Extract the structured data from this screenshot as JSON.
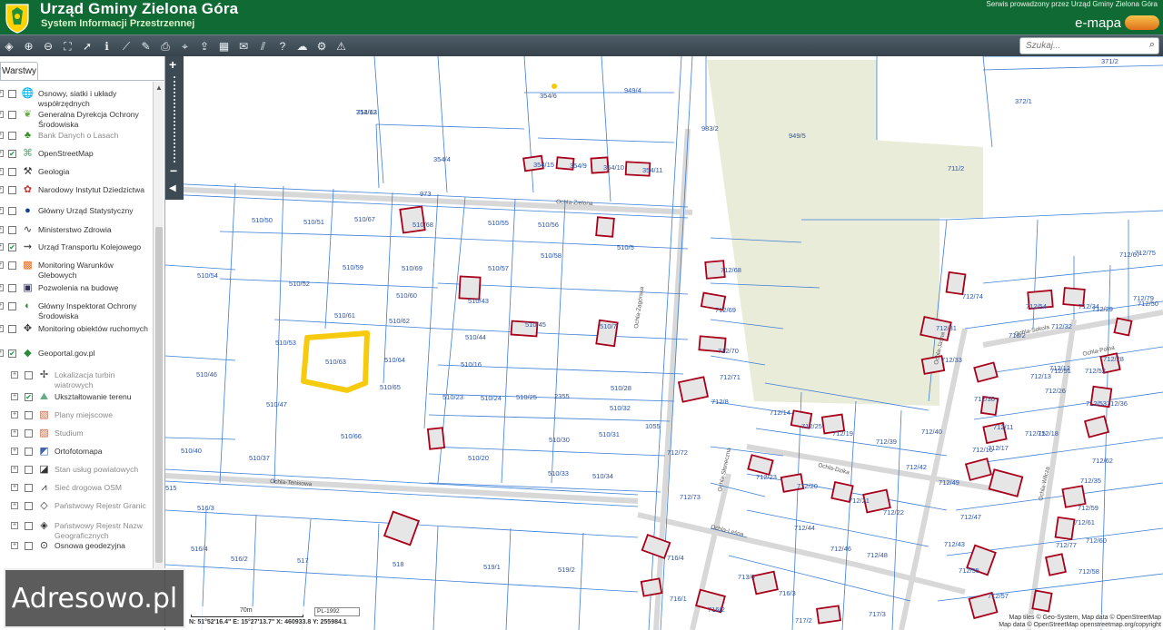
{
  "header": {
    "title": "Urząd Gminy Zielona Góra",
    "subtitle": "System Informacji Przestrzennej",
    "service_note": "Serwis prowadzony przez Urząd Gminy Zielona Góra",
    "brand": "e-mapa"
  },
  "toolbar": {
    "search_placeholder": "Szukaj...",
    "tools": [
      "layers-icon",
      "zoom-in-icon",
      "zoom-out-icon",
      "zoom-extent-icon",
      "pointer-icon",
      "info-icon",
      "measure-distance-icon",
      "measure-area-icon",
      "print-icon",
      "location-icon",
      "export-icon",
      "layout-icon",
      "comment-icon",
      "hatch-icon",
      "help-icon",
      "cloud-icon",
      "settings-icon",
      "warning-icon"
    ]
  },
  "panel": {
    "tab_label": "Warstwy",
    "layers": [
      {
        "label": "Osnowy, siatki i układy współrzędnych",
        "checked": false,
        "dim": false,
        "icon": "globe-icon",
        "level": 0
      },
      {
        "label": "Generalna Dyrekcja Ochrony Środowiska",
        "checked": false,
        "dim": false,
        "icon": "leaf-icon",
        "level": 0
      },
      {
        "label": "Bank Danych o Lasach",
        "checked": false,
        "dim": true,
        "icon": "tree-icon",
        "level": 0
      },
      {
        "label": "OpenStreetMap",
        "checked": true,
        "dim": false,
        "icon": "osm-icon",
        "level": 0
      },
      {
        "label": "Geologia",
        "checked": false,
        "dim": false,
        "icon": "hammers-icon",
        "level": 0
      },
      {
        "label": "Narodowy Instytut Dziedzictwa",
        "checked": false,
        "dim": false,
        "icon": "heritage-icon",
        "level": 0
      },
      {
        "label": "Główny Urząd Statystyczny",
        "checked": false,
        "dim": false,
        "icon": "stats-icon",
        "level": 0
      },
      {
        "label": "Ministerstwo Zdrowia",
        "checked": false,
        "dim": false,
        "icon": "health-icon",
        "level": 0
      },
      {
        "label": "Urząd Transportu Kolejowego",
        "checked": true,
        "dim": false,
        "icon": "rail-icon",
        "level": 0
      },
      {
        "label": "Monitoring Warunków Glebowych",
        "checked": false,
        "dim": false,
        "icon": "soil-icon",
        "level": 0
      },
      {
        "label": "Pozwolenia na budowę",
        "checked": false,
        "dim": false,
        "icon": "permit-icon",
        "level": 0
      },
      {
        "label": "Główny Inspektorat Ochrony Środowiska",
        "checked": false,
        "dim": false,
        "icon": "environment-icon",
        "level": 0
      },
      {
        "label": "Monitoring obiektów ruchomych",
        "checked": false,
        "dim": false,
        "icon": "tracking-icon",
        "level": 0
      },
      {
        "label": "Geoportal.gov.pl",
        "checked": true,
        "dim": false,
        "icon": "geoportal-icon",
        "level": 0
      },
      {
        "label": "Lokalizacja turbin wiatrowych",
        "checked": false,
        "dim": true,
        "icon": "turbine-icon",
        "level": 1
      },
      {
        "label": "Ukształtowanie terenu",
        "checked": true,
        "dim": false,
        "icon": "terrain-icon",
        "level": 1
      },
      {
        "label": "Plany miejscowe",
        "checked": false,
        "dim": true,
        "icon": "plan-icon",
        "level": 1
      },
      {
        "label": "Studium",
        "checked": false,
        "dim": true,
        "icon": "study-icon",
        "level": 1
      },
      {
        "label": "Ortofotomapa",
        "checked": false,
        "dim": false,
        "icon": "ortho-icon",
        "level": 1
      },
      {
        "label": "Stan usług powiatowych",
        "checked": false,
        "dim": true,
        "icon": "services-icon",
        "level": 1
      },
      {
        "label": "Sieć drogowa OSM",
        "checked": false,
        "dim": true,
        "icon": "road-icon",
        "level": 1
      },
      {
        "label": "Państwowy Rejestr Granic",
        "checked": false,
        "dim": true,
        "icon": "border-icon",
        "level": 1
      },
      {
        "label": "Państwowy Rejestr Nazw Geograficznych",
        "checked": false,
        "dim": true,
        "icon": "names-icon",
        "level": 1
      },
      {
        "label": "Osnowa geodezyjna",
        "checked": false,
        "dim": false,
        "icon": "geodesy-icon",
        "level": 1
      }
    ]
  },
  "map": {
    "streets": [
      "Ochla-Zielona",
      "Ochla-Zagórska",
      "Ochla-Tenisowa",
      "Ochla-Sokola",
      "Ochla-Dzika",
      "Ochla-Leśna",
      "Ochla-Słoneczna",
      "Ochla-Wilcza",
      "Ochla-Polna",
      "Ochla-Jasna"
    ],
    "parcels": [
      "354/12",
      "354/6",
      "949/4",
      "371/2",
      "372/1",
      "983/2",
      "949/5",
      "354/4",
      "354/15",
      "354/9",
      "354/10",
      "354/11",
      "973",
      "510/50",
      "510/51",
      "510/67",
      "510/68",
      "510/55",
      "510/56",
      "510/54",
      "510/59",
      "510/69",
      "510/57",
      "510/58",
      "510/5",
      "510/52",
      "510/60",
      "510/43",
      "510/61",
      "510/62",
      "510/53",
      "510/63",
      "510/64",
      "510/44",
      "510/45",
      "510/7",
      "510/46",
      "510/16",
      "510/65",
      "510/23",
      "510/24",
      "510/25",
      "2355",
      "510/28",
      "510/47",
      "510/32",
      "510/40",
      "510/66",
      "510/30",
      "510/31",
      "510/37",
      "510/20",
      "510/33",
      "510/34",
      "1055",
      "516/3",
      "516/4",
      "516/2",
      "517",
      "518",
      "519/1",
      "519/2",
      "515",
      "712/68",
      "712/69",
      "712/70",
      "712/71",
      "712/8",
      "712/72",
      "712/73",
      "712/74",
      "712/75",
      "712/67",
      "711/2",
      "712/29",
      "712/79",
      "712/50",
      "712/28",
      "712/33",
      "712/26",
      "712/30",
      "712/36",
      "712/11",
      "712/12",
      "712/13",
      "712/14",
      "712/25",
      "712/19",
      "712/39",
      "712/40",
      "712/15",
      "712/16",
      "712/17",
      "712/18",
      "712/23",
      "712/20",
      "712/21",
      "712/22",
      "712/42",
      "712/44",
      "712/46",
      "712/48",
      "712/49",
      "712/47",
      "712/43",
      "712/55",
      "712/57",
      "712/58",
      "712/59",
      "712/77",
      "713/6",
      "716/4",
      "716/1",
      "716/2",
      "716/3",
      "717/2",
      "717/3",
      "718/2",
      "712/51",
      "712/52",
      "712/53",
      "712/54",
      "712/31",
      "712/32",
      "712/34",
      "712/35",
      "712/60",
      "712/61",
      "712/62",
      "712/63"
    ],
    "zoom_plus": "+",
    "zoom_minus": "−"
  },
  "status": {
    "scale_label": "70m",
    "scale_select": "PL-1992",
    "coords": "N: 51°52'16.4\"  E: 15°27'13.7\"  X: 460933.8  Y: 255984.1"
  },
  "attribution": {
    "line1": "Map tiles © Geo-System, Map data © OpenStreetMap",
    "line2": "Map data © OpenStreetMap openstreetmap.org/copyright"
  },
  "watermark": "Adresowo.pl",
  "colors": {
    "header": "#0f6a33",
    "toolbar": "#3d4a54",
    "parcel_line": "#2a6fc9",
    "building": "#b00010",
    "highlight": "#f5c800",
    "forest": "#e8ecd7"
  }
}
